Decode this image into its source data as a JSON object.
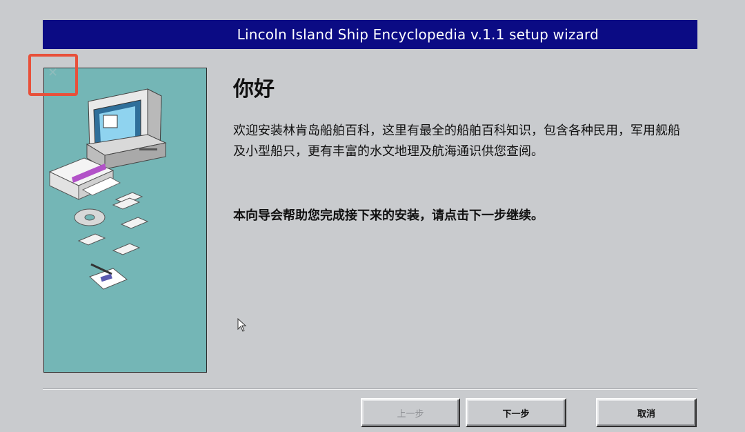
{
  "window": {
    "title": "Lincoln Island Ship Encyclopedia v.1.1 setup wizard"
  },
  "content": {
    "heading": "你好",
    "paragraph1": "欢迎安装林肯岛船舶百科，这里有最全的船舶百科知识，包含各种民用，军用舰船及小型船只，更有丰富的水文地理及航海通识供您查阅。",
    "paragraph2": "本向导会帮助您完成接下来的安装，请点击下一步继续。"
  },
  "buttons": {
    "prev_label": "上一步",
    "next_label": "下一步",
    "cancel_label": "取消",
    "prev_enabled": false
  },
  "icons": {
    "close": "close-icon",
    "illustration": "computer-install-illustration",
    "cursor": "mouse-pointer-icon"
  },
  "colors": {
    "titlebar": "#0b0b84",
    "side_panel": "#74b6b6",
    "highlight": "#e8503a",
    "background": "#c9cbce"
  }
}
